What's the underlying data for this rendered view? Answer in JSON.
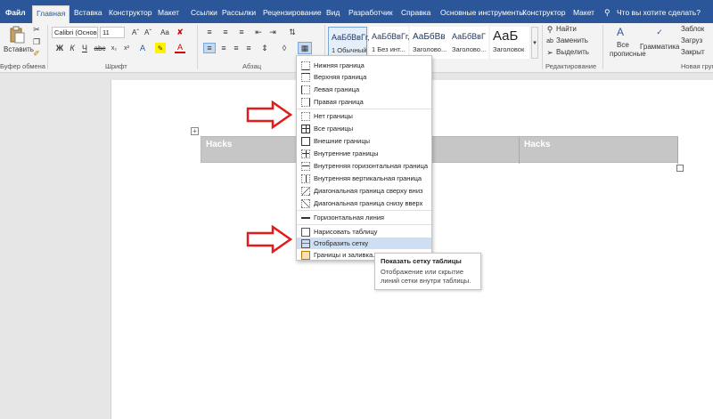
{
  "tabs": [
    {
      "label": "Файл",
      "file": true
    },
    {
      "label": "Главная",
      "active": true
    },
    {
      "label": "Вставка"
    },
    {
      "label": "Конструктор"
    },
    {
      "label": "Макет"
    },
    {
      "label": "Ссылки"
    },
    {
      "label": "Рассылки"
    },
    {
      "label": "Рецензирование"
    },
    {
      "label": "Вид"
    },
    {
      "label": "Разработчик"
    },
    {
      "label": "Справка"
    },
    {
      "label": "Основные инструменты"
    },
    {
      "label": "Конструктор"
    },
    {
      "label": "Макет"
    }
  ],
  "tell_me": "Что вы хотите сделать?",
  "ribbon": {
    "paste_label": "Вставить",
    "clipboard_group": "Буфер обмена",
    "font_name": "Calibri (Основ",
    "font_size": "11",
    "font_group": "Шрифт",
    "paragraph_group": "Абзац",
    "styles": [
      {
        "sample": "АаБбВвГг,",
        "name": "1 Обычный"
      },
      {
        "sample": "АаБбВвГг,",
        "name": "1 Без инт..."
      },
      {
        "sample": "АаБбВв",
        "name": "Заголово..."
      },
      {
        "sample": "АаБбВвГ",
        "name": "Заголово..."
      },
      {
        "sample": "АаБ",
        "name": "Заголовок"
      }
    ],
    "find": "Найти",
    "replace": "Заменить",
    "select": "Выделить",
    "editing_group": "Редактирование",
    "caps_label_1": "Все",
    "caps_label_2": "прописные",
    "grammar_label": "Грамматика",
    "side_1": "Заблок",
    "side_2": "Загруз",
    "side_3": "Закрыт",
    "new_group": "Новая груп"
  },
  "table": {
    "cell1": "Hacks",
    "cell2": "Hacks"
  },
  "menu": {
    "items": [
      "Нижняя граница",
      "Верхняя граница",
      "Левая граница",
      "Правая граница",
      "Нет границы",
      "Все границы",
      "Внешние границы",
      "Внутренние границы",
      "Внутренняя горизонтальная граница",
      "Внутренняя вертикальная граница",
      "Диагональная граница сверху вниз",
      "Диагональная граница снизу вверх",
      "Горизонтальная линия",
      "Нарисовать таблицу",
      "Отобразить сетку",
      "Границы и заливка..."
    ]
  },
  "tooltip": {
    "title": "Показать сетку таблицы",
    "body": "Отображение или скрытие линий сетки внутри таблицы."
  },
  "colors": {
    "accent": "#2b579a",
    "arrow": "#e21b1b",
    "hover": "#cfdff3"
  }
}
